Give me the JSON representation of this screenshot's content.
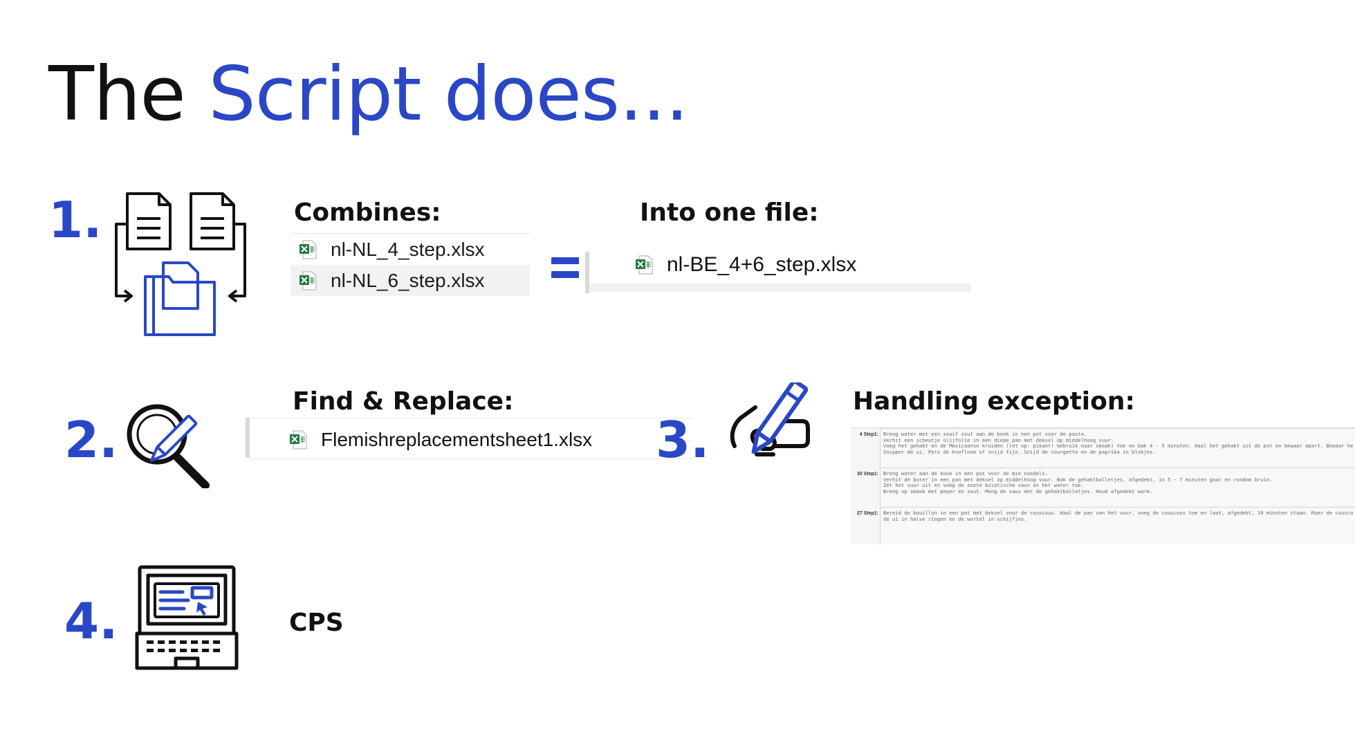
{
  "title": {
    "plain": "The",
    "accent": "Script does..."
  },
  "steps": [
    {
      "number": "1.",
      "heading": "Combines:",
      "files": [
        "nl-NL_4_step.xlsx",
        "nl-NL_6_step.xlsx"
      ],
      "result_heading": "Into one file:",
      "result_file": "nl-BE_4+6_step.xlsx"
    },
    {
      "number": "2.",
      "heading": "Find & Replace:",
      "file": "Flemishreplacementsheet1.xlsx"
    },
    {
      "number": "3.",
      "heading": "Handling exception:",
      "rows": [
        {
          "label": "4 Step1:",
          "lines": [
            "Breng water met een snuif zout aan de kook in een pot voor de pasta.",
            "Verhit een scheutje olijfolie in een diepe pan met deksel op middelhoog vuur.",
            "Voeg het gehakt en de Mexicaanse kruiden (let op: pikant! Gebruik naar smaak) toe en bak 4 - 5 minuten. Haal het gehakt uit de pot en bewaar apart. Bewaar he",
            "Snipper de ui. Pers de knoflook of snijd fijn. Snijd de courgette en de paprika in blokjes."
          ]
        },
        {
          "label": "30 Step1:",
          "lines": [
            "Breng water aan de kook in een pot voor de mie noedels.",
            "Verhit de boter in een pan met deksel op middelhoog vuur. Bak de gehaktballetjes, afgedekt, in 5 - 7 minuten gaar en rondom bruin.",
            "Zet het vuur uit en voeg de zoete Aziatische saus en het water toe.",
            "Breng op smaak met peper en zout. Meng de saus met de gehaktballetjes. Houd afgedekt warm."
          ]
        },
        {
          "label": "27 Step1:",
          "lines": [
            "Bereid de bouillon in een pot met deksel voor de couscous. Haal de pan van het vuur, voeg de couscous toe en laat, afgedekt, 10 minuten staan. Roer de cousco",
            "de ui in halve ringen en de wortel in schijfjes."
          ]
        }
      ]
    },
    {
      "number": "4.",
      "heading": "CPS"
    }
  ],
  "colors": {
    "accent": "#2a47c6",
    "text": "#111111",
    "excel_green": "#1f7a43"
  },
  "icons": [
    "documents-merge-icon",
    "search-edit-icon",
    "hand-pen-icon",
    "laptop-form-icon",
    "excel-file-icon"
  ]
}
